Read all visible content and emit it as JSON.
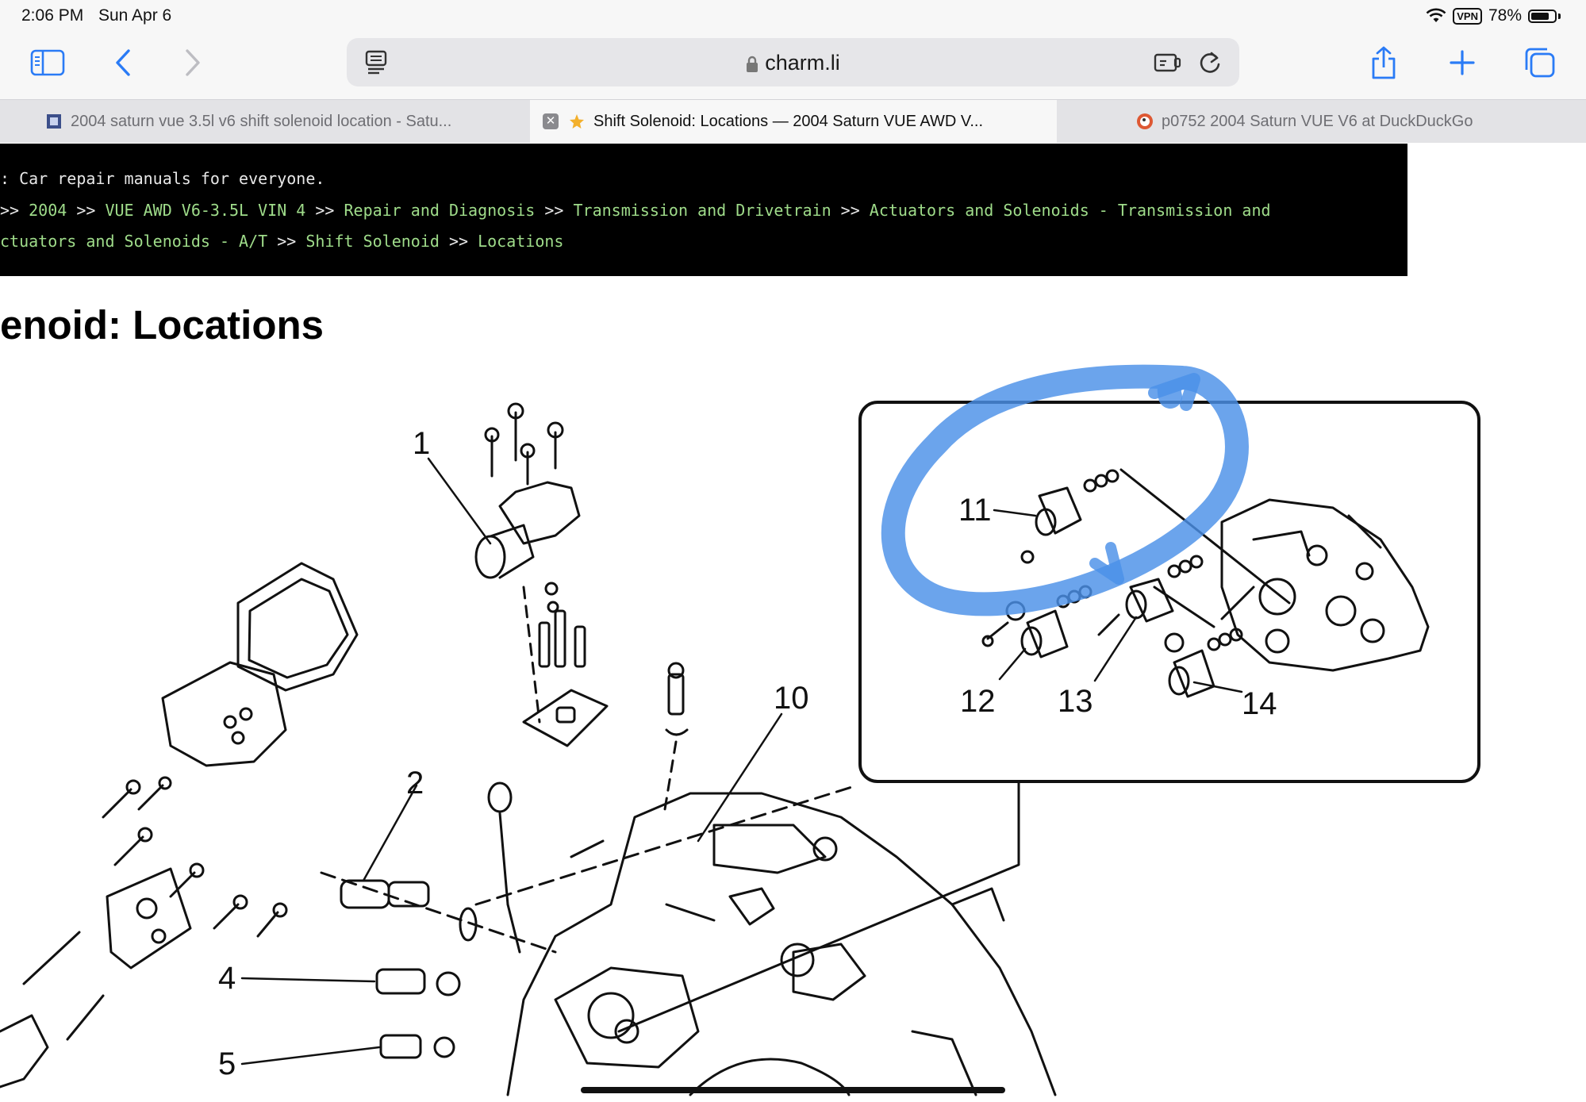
{
  "status_bar": {
    "time": "2:06 PM",
    "date": "Sun Apr 6",
    "vpn": "VPN",
    "battery": "78%",
    "battery_level": 0.78
  },
  "toolbar": {
    "url": "charm.li",
    "icons": [
      "sidebar-icon",
      "back-icon",
      "forward-icon",
      "reader-icon",
      "lock-icon",
      "extension-icon",
      "reload-icon",
      "share-icon",
      "new-tab-icon",
      "tabs-overview-icon"
    ]
  },
  "tabs": [
    {
      "title": "2004 saturn vue 3.5l v6 shift solenoid location - Satu...",
      "active": false
    },
    {
      "title": "Shift Solenoid: Locations — 2004 Saturn VUE AWD V...",
      "active": true
    },
    {
      "title": "p0752 2004 Saturn VUE V6 at DuckDuckGo",
      "active": false
    }
  ],
  "header": {
    "tagline": ": Car repair manuals for everyone.",
    "crumbs_line1": [
      {
        "sep": ">> ",
        "text": "2004"
      },
      {
        "sep": " >> ",
        "text": "VUE AWD V6-3.5L VIN 4"
      },
      {
        "sep": " >> ",
        "text": "Repair and Diagnosis"
      },
      {
        "sep": " >> ",
        "text": "Transmission and Drivetrain"
      },
      {
        "sep": " >> ",
        "text": "Actuators and Solenoids - Transmission and"
      }
    ],
    "crumbs_line2": [
      {
        "sep": "",
        "text": "ctuators and Solenoids - A/T"
      },
      {
        "sep": " >> ",
        "text": "Shift Solenoid"
      },
      {
        "sep": " >> ",
        "text": "Locations"
      }
    ]
  },
  "page": {
    "title": "enoid: Locations"
  },
  "diagram": {
    "callouts": [
      "1",
      "2",
      "4",
      "5",
      "10",
      "11",
      "12",
      "13",
      "14"
    ],
    "highlight_color": "#4a90e8"
  },
  "colors": {
    "link_green": "#9fdc8a",
    "toolbar_blue": "#2a7bf6"
  }
}
